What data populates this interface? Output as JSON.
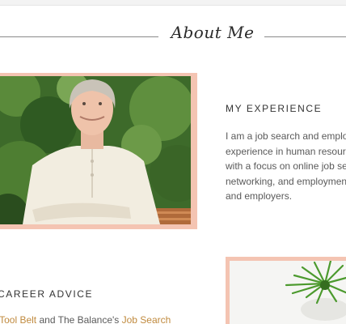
{
  "section": {
    "title": "About Me"
  },
  "experience": {
    "heading": "MY EXPERIENCE",
    "lines": [
      "I am a job search and employ",
      "experience in human resourc",
      "with a focus on online job sea",
      "networking, and employment",
      "and employers."
    ]
  },
  "career": {
    "heading": "CAREER ADVICE",
    "link1": "r Tool Belt",
    "middle": " and The Balance's ",
    "link2": "Job Search"
  },
  "colors": {
    "accent_frame": "#f4c4b2",
    "link": "#c08a3e"
  }
}
